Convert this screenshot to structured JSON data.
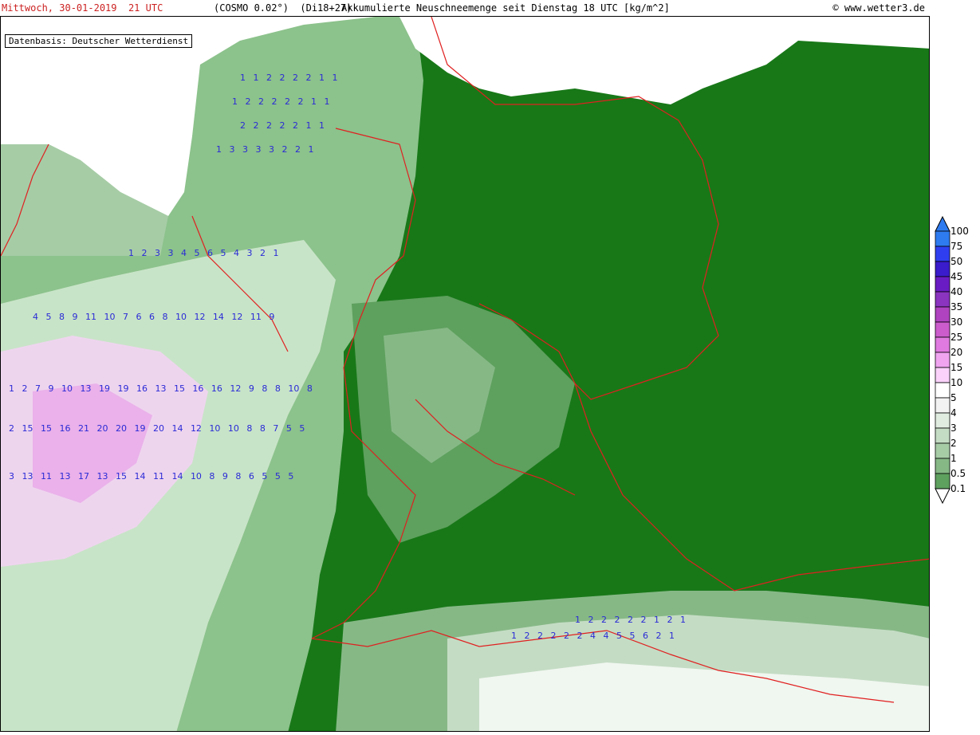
{
  "header": {
    "datetime": "Mittwoch, 30-01-2019  21 UTC",
    "model": "(COSMO 0.02°)  (Di18+27)",
    "description": "Akkumulierte Neuschneemenge seit Dienstag 18 UTC [kg/m^2]",
    "copyright": "© www.wetter3.de"
  },
  "map": {
    "basis_label": "Datenbasis: Deutscher Wetterdienst",
    "colors": {
      "land_dark_green": "#187818",
      "sea_white": "#ffffff",
      "border_red": "#e02020",
      "value_blue": "#2a2ad6"
    },
    "value_grid_sample_rows": [
      "1 1 2 2 2 2 1 1",
      "1 2 2 2 2 2 1 1",
      "2 2 2 2 2 1 1",
      "1 3 3 3 3 2 2 1",
      "1 2 3 3 4 5 6 5 4 3 2 1",
      "4 5 8 9 11 10 7 6 6 8 10 12 14 12 11 9",
      "1 2 7 9 10 13 19 19 16 13 15 16 16 12 9 8 8 10 8",
      "2 15 15 16 21 20 20 19 20 14 12 10 10 8 8 7 5 5",
      "3 13 11 13 17 13 15 14 11 14 10 8 9 8 6 5 5 5",
      "1 2 2 2 2 2 1 2 1",
      "1 2 2 2 2 2 4 4 5 5 6 2 1"
    ]
  },
  "legend": {
    "levels": [
      "100",
      "75",
      "50",
      "45",
      "40",
      "35",
      "30",
      "25",
      "20",
      "15",
      "10",
      "5",
      "4",
      "3",
      "2",
      "1",
      "0.5",
      "0.1"
    ],
    "colors": [
      "#2e7bf0",
      "#2f3ff0",
      "#3a1ccc",
      "#6a1cc4",
      "#8a34c0",
      "#b044c0",
      "#cc5ccc",
      "#e07ae0",
      "#f0a4f0",
      "#fad2fa",
      "#ffffff",
      "#f2f2f2",
      "#e0ece0",
      "#c4dcc4",
      "#a6cca6",
      "#86b886",
      "#5ea05e",
      "#2c802c"
    ]
  }
}
